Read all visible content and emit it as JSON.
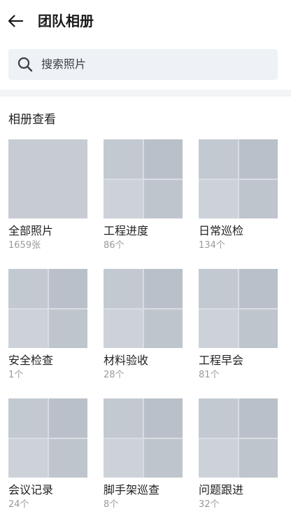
{
  "header": {
    "title": "团队相册",
    "back_icon": "arrow-left-icon"
  },
  "search": {
    "placeholder": "搜索照片",
    "icon": "search-icon"
  },
  "section": {
    "title": "相册查看"
  },
  "albums": [
    {
      "name": "全部照片",
      "count": "1659张"
    },
    {
      "name": "工程进度",
      "count": "86个"
    },
    {
      "name": "日常巡检",
      "count": "134个"
    },
    {
      "name": "安全检查",
      "count": "1个"
    },
    {
      "name": "材料验收",
      "count": "28个"
    },
    {
      "name": "工程早会",
      "count": "81个"
    },
    {
      "name": "会议记录",
      "count": "24个"
    },
    {
      "name": "脚手架巡查",
      "count": "8个"
    },
    {
      "name": "问题跟进",
      "count": "32个"
    }
  ],
  "colors": {
    "search_background": "#eef1f5",
    "divider": "#f2f4f7",
    "count_text": "#9a9a9a"
  }
}
